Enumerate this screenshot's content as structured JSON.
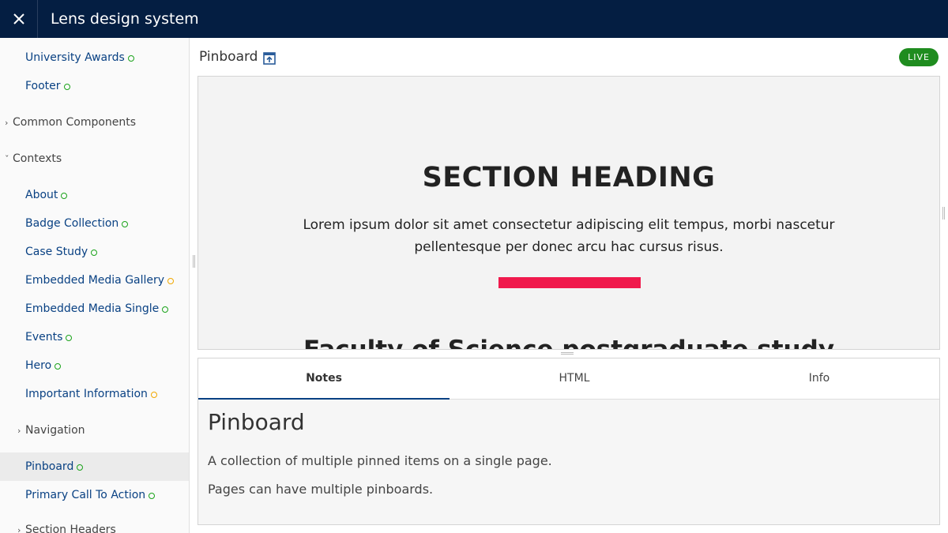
{
  "app": {
    "title": "Lens design system"
  },
  "sidebar": {
    "items": [
      {
        "label": "University Awards",
        "status": "ready"
      },
      {
        "label": "Footer",
        "status": "ready"
      },
      {
        "label": "Common Components",
        "group": true,
        "expanded": false
      },
      {
        "label": "Contexts",
        "group": true,
        "expanded": true
      },
      {
        "label": "About",
        "status": "ready"
      },
      {
        "label": "Badge Collection",
        "status": "ready"
      },
      {
        "label": "Case Study",
        "status": "ready"
      },
      {
        "label": "Embedded Media Gallery",
        "status": "wip"
      },
      {
        "label": "Embedded Media Single",
        "status": "ready"
      },
      {
        "label": "Events",
        "status": "ready"
      },
      {
        "label": "Hero",
        "status": "ready"
      },
      {
        "label": "Important Information",
        "status": "wip"
      },
      {
        "label": "Navigation",
        "group": true,
        "expanded": false
      },
      {
        "label": "Pinboard",
        "status": "ready",
        "selected": true
      },
      {
        "label": "Primary Call To Action",
        "status": "ready"
      },
      {
        "label": "Section Headers",
        "group": true,
        "expanded": false
      }
    ]
  },
  "component": {
    "title": "Pinboard",
    "status_badge": "LIVE"
  },
  "preview": {
    "heading": "SECTION HEADING",
    "body": "Lorem ipsum dolor sit amet consectetur adipiscing elit tempus, morbi nascetur pellentesque per donec arcu hac cursus risus.",
    "link": "Faculty of Science postgraduate study",
    "accent_color": "#f0194c"
  },
  "panel": {
    "tabs": [
      {
        "label": "Notes",
        "active": true
      },
      {
        "label": "HTML",
        "active": false
      },
      {
        "label": "Info",
        "active": false
      }
    ],
    "notes": {
      "heading": "Pinboard",
      "paragraphs": [
        "A collection of multiple pinned items on a single page.",
        "Pages can have multiple pinboards."
      ]
    }
  },
  "colors": {
    "topbar": "#041e42",
    "link": "#094183",
    "live": "#1f8c1f",
    "ready": "#1aa31a",
    "wip": "#f0a800"
  }
}
